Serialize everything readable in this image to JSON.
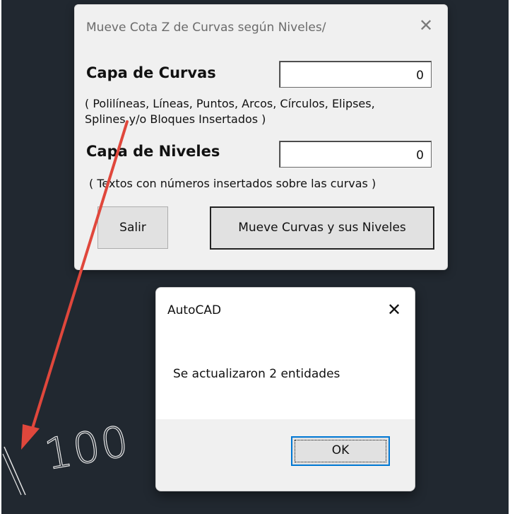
{
  "drawing": {
    "dimension_text": "100"
  },
  "main_dialog": {
    "title": "Mueve Cota Z de Curvas según Niveles/",
    "close_glyph": "✕",
    "curves_layer_label": "Capa de Curvas",
    "curves_layer_value": "0",
    "curves_note_line1": "( Polilíneas, Líneas, Puntos, Arcos, Círculos, Elipses,",
    "curves_note_line2": "Splines y/o Bloques Insertados )",
    "levels_layer_label": "Capa de Niveles",
    "levels_layer_value": "0",
    "levels_note": "( Textos con números insertados sobre las curvas )",
    "exit_button": "Salir",
    "move_button": "Mueve Curvas y sus Niveles"
  },
  "message_box": {
    "title": "AutoCAD",
    "close_glyph": "✕",
    "message": "Se actualizaron 2 entidades",
    "ok_button": "OK"
  },
  "colors": {
    "canvas_background": "#212830",
    "annotation_arrow": "#e0473c",
    "ok_focus_border": "#0078d4"
  }
}
